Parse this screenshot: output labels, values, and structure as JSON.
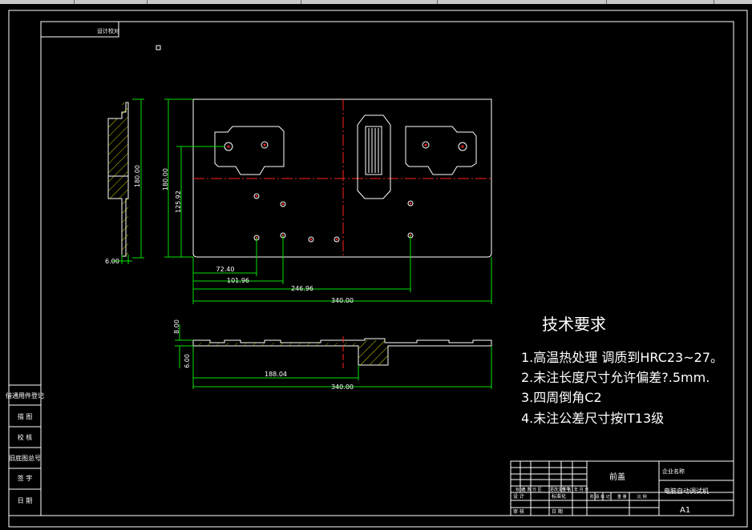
{
  "drawing": {
    "corner_tag": "设计校对",
    "tech_title": "技术要求",
    "tech_notes": [
      "1.高温热处理  调质到HRC23~27。",
      "2.未注长度尺寸允许偏差?.5mm.",
      "3.四周倒角C2",
      "4.未注公差尺寸按IT13级"
    ],
    "dims": {
      "left_180": "180.00",
      "left_6": "6.00",
      "h_180": "180.00",
      "h_125": "125.92",
      "d72": "72.40",
      "d101": "101.96",
      "d246": "246.96",
      "d340a": "340.00",
      "s8": "8.00",
      "s6": "6.00",
      "d188": "188.04",
      "d340b": "340.00"
    },
    "side_table": [
      "借通用件登记",
      "描  图",
      "校  核",
      "旧底图总号",
      "签  字",
      "日  期"
    ],
    "title_block": {
      "part_name": "前盖",
      "company": "企业名称",
      "product": "电脑自动调试机",
      "sheet": "A1",
      "row_labels": [
        "标 记",
        "处 数",
        "分 区",
        "更改文件号",
        "签 名",
        "年 月 日"
      ],
      "row2": [
        "设 计",
        "",
        "",
        "标准化",
        ""
      ],
      "row3": [
        "审 核",
        "",
        "",
        "日 期",
        ""
      ],
      "right_labels": [
        "阶 段 标 记",
        "重 量",
        "比 例"
      ]
    },
    "colors": {
      "line": "#ffffff",
      "center": "#ff2020",
      "dim": "#00e000",
      "hatch": "#e0e000"
    }
  }
}
